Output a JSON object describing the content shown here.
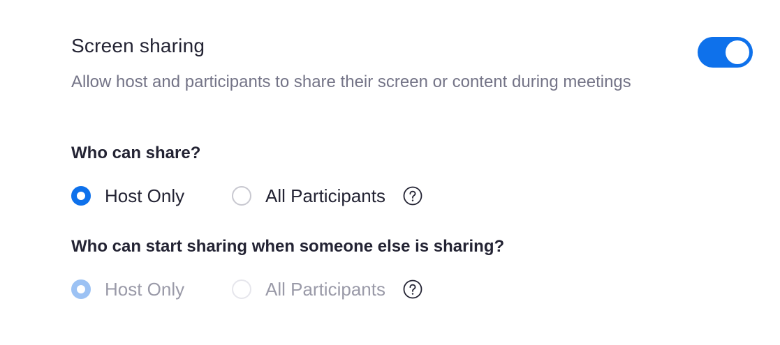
{
  "setting": {
    "title": "Screen sharing",
    "description": "Allow host and participants to share their screen or content during meetings",
    "enabled": true,
    "toggle_color": "#0e71eb"
  },
  "who_can_share": {
    "question": "Who can share?",
    "options": [
      {
        "label": "Host Only",
        "selected": true
      },
      {
        "label": "All Participants",
        "selected": false
      }
    ],
    "help_icon": "question-circle-icon"
  },
  "who_can_start_sharing": {
    "question": "Who can start sharing when someone else is sharing?",
    "disabled": true,
    "options": [
      {
        "label": "Host Only",
        "selected": true
      },
      {
        "label": "All Participants",
        "selected": false
      }
    ],
    "help_icon": "question-circle-icon"
  }
}
